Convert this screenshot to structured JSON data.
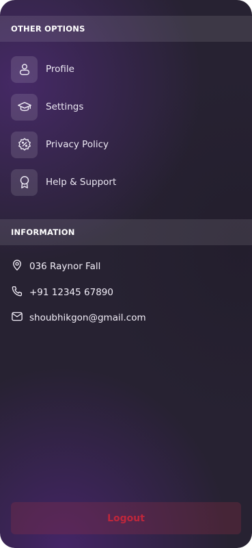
{
  "sections": {
    "other_options": {
      "title": "OTHER OPTIONS"
    },
    "information": {
      "title": "INFORMATION"
    }
  },
  "menu": {
    "items": [
      {
        "label": "Profile",
        "icon": "user-icon"
      },
      {
        "label": "Settings",
        "icon": "graduation-cap-icon"
      },
      {
        "label": "Privacy Policy",
        "icon": "badge-percent-icon"
      },
      {
        "label": "Help & Support",
        "icon": "award-ribbon-icon"
      }
    ]
  },
  "info": {
    "address": "036 Raynor Fall",
    "phone": "+91 12345 67890",
    "email": "shoubhikgon@gmail.com"
  },
  "logout": {
    "label": "Logout"
  },
  "colors": {
    "background": "#272232",
    "accent_purple": "#4e2678",
    "logout_text": "#c0263b"
  }
}
